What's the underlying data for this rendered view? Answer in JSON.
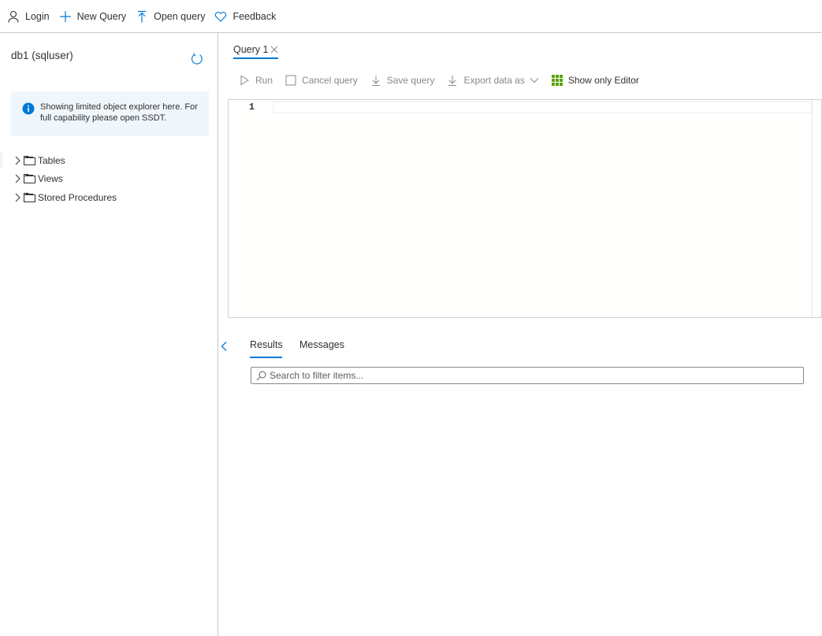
{
  "topbar": {
    "login_label": "Login",
    "new_query_label": "New Query",
    "open_query_label": "Open query",
    "feedback_label": "Feedback"
  },
  "explorer": {
    "db_title": "db1 (sqluser)",
    "info_text": "Showing limited object explorer here. For full capability please open SSDT.",
    "tree": [
      {
        "label": "Tables"
      },
      {
        "label": "Views"
      },
      {
        "label": "Stored Procedures"
      }
    ]
  },
  "query_tab": {
    "label": "Query 1"
  },
  "toolbar": {
    "run_label": "Run",
    "cancel_label": "Cancel query",
    "save_label": "Save query",
    "export_label": "Export data as",
    "show_editor_label": "Show only Editor"
  },
  "editor": {
    "line_numbers": [
      "1"
    ],
    "content": ""
  },
  "results": {
    "results_tab": "Results",
    "messages_tab": "Messages",
    "search_placeholder": "Search to filter items..."
  },
  "colors": {
    "accent": "#0078d4",
    "info_bg": "#eff6fc",
    "grid_icon": "#57a300"
  },
  "icons": {
    "login": "person-icon",
    "new_query": "plus-icon",
    "open_query": "upload-icon",
    "feedback": "heart-icon",
    "refresh": "refresh-icon",
    "info": "info-icon",
    "run": "play-icon",
    "cancel": "stop-icon",
    "save": "download-icon",
    "export": "download-icon",
    "show_editor": "grid-icon"
  }
}
